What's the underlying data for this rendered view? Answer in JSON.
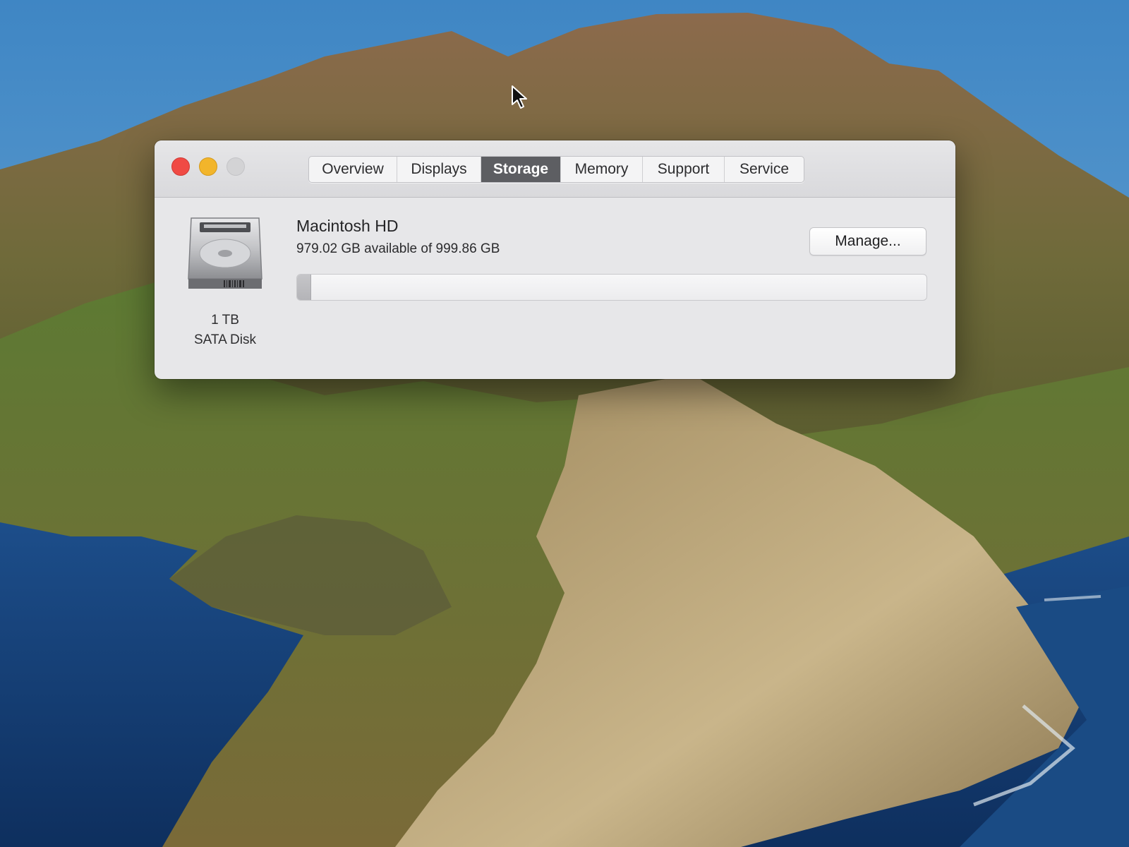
{
  "window": {
    "tabs": [
      {
        "label": "Overview",
        "active": false
      },
      {
        "label": "Displays",
        "active": false
      },
      {
        "label": "Storage",
        "active": true
      },
      {
        "label": "Memory",
        "active": false
      },
      {
        "label": "Support",
        "active": false
      },
      {
        "label": "Service",
        "active": false
      }
    ],
    "traffic_lights": {
      "close": "#f04a44",
      "minimize": "#f2b52b",
      "zoom": "#d3d3d5"
    }
  },
  "storage": {
    "disk_icon": "hard-drive-icon",
    "disk_capacity": "1 TB",
    "disk_type": "SATA Disk",
    "volume_name": "Macintosh HD",
    "available_text": "979.02 GB available of 999.86 GB",
    "used_fraction": 0.021,
    "manage_label": "Manage..."
  },
  "colors": {
    "active_tab": "#5d5e62",
    "window_bg": "#e7e7e9"
  }
}
